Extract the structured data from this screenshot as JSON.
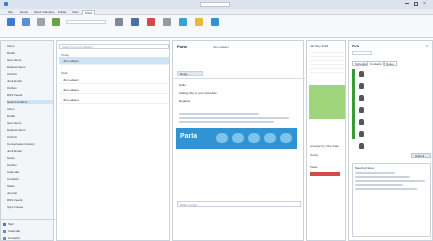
{
  "ribbon": {
    "tabs": [
      "File",
      "Home",
      "Send / Receive",
      "Folder",
      "View",
      "Parla"
    ],
    "active_tab": "Parla",
    "groups": [
      "New",
      "Delete",
      "Respond",
      "Quick Steps",
      "Move",
      "Tags",
      "Find",
      "Parla"
    ]
  },
  "nav": {
    "items": [
      "Inbox",
      "Drafts",
      "Sent Items",
      "Deleted Items",
      "Archive",
      "Junk Email",
      "Outbox",
      "RSS Feeds",
      "Search Folders",
      "Inbox",
      "Drafts",
      "Sent Items",
      "Deleted Items",
      "Archive",
      "Conversation History",
      "Junk Email",
      "Notes",
      "Outbox",
      "Calendar",
      "Contacts",
      "Tasks",
      "Journal",
      "RSS Feeds",
      "Sync Issues",
      "Mail",
      "Calendar",
      "Contacts"
    ],
    "selected_index": 8
  },
  "list": {
    "search_placeholder": "Search Current Mailbox",
    "groups": [
      "Today",
      "Older"
    ],
    "rows": [
      "Jitu Lalwani",
      "Jitu Lalwani",
      "Jitu Lalwani",
      "Jitu Lalwani"
    ]
  },
  "reading": {
    "from": "Jitu Lalwani",
    "subject": "Parla",
    "action": "Reply",
    "lines": [
      "Hello",
      "Adding this to your schedule",
      "Regards"
    ],
    "banner_text": "Parla",
    "reply_placeholder": "Write a reply..."
  },
  "calendar": {
    "month": "January 2018",
    "today_label": "Today",
    "tasks_label": "Tasks",
    "due_label": "Arrange by: Due Date"
  },
  "right": {
    "header": "Parla",
    "tabs": [
      "Schedule",
      "Contacts",
      "Notes"
    ],
    "button": "Submit",
    "notes_title": "Meeting Notes"
  }
}
